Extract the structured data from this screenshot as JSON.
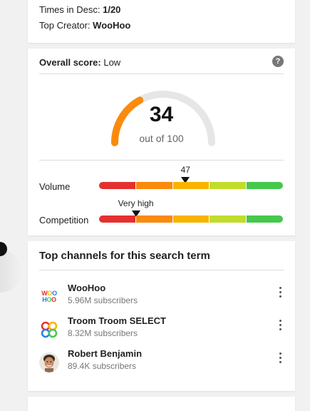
{
  "top_stats": {
    "desc_label": "Times in Desc:",
    "desc_value": "1/20",
    "creator_label": "Top Creator:",
    "creator_value": "WooHoo"
  },
  "score": {
    "label": "Overall score:",
    "value_word": "Low",
    "number": "34",
    "out_of": "out of 100",
    "number_value": 34,
    "max": 100,
    "help_icon": "question-circle-icon"
  },
  "volume": {
    "label": "Volume",
    "marker_text": "47",
    "marker_value": 47
  },
  "competition": {
    "label": "Competition",
    "marker_text": "Very high",
    "marker_value": 20
  },
  "colors": {
    "gauge_fill": "#fb8a0d",
    "gauge_track": "#e6e6e6",
    "bar_segments": [
      "#e53030",
      "#fb8a0d",
      "#f9b400",
      "#c2dc2a",
      "#45c84b"
    ]
  },
  "channels": {
    "title": "Top channels for this search term",
    "items": [
      {
        "name": "WooHoo",
        "subscribers": "5.96M subscribers",
        "avatar": "woohoo-logo",
        "logo_rows": [
          "WOO",
          "HOO"
        ]
      },
      {
        "name": "Troom Troom SELECT",
        "subscribers": "8.32M subscribers",
        "avatar": "troom-troom-logo"
      },
      {
        "name": "Robert Benjamin",
        "subscribers": "89.4K subscribers",
        "avatar": "person-avatar"
      }
    ],
    "more_icon": "more-vertical-icon"
  }
}
